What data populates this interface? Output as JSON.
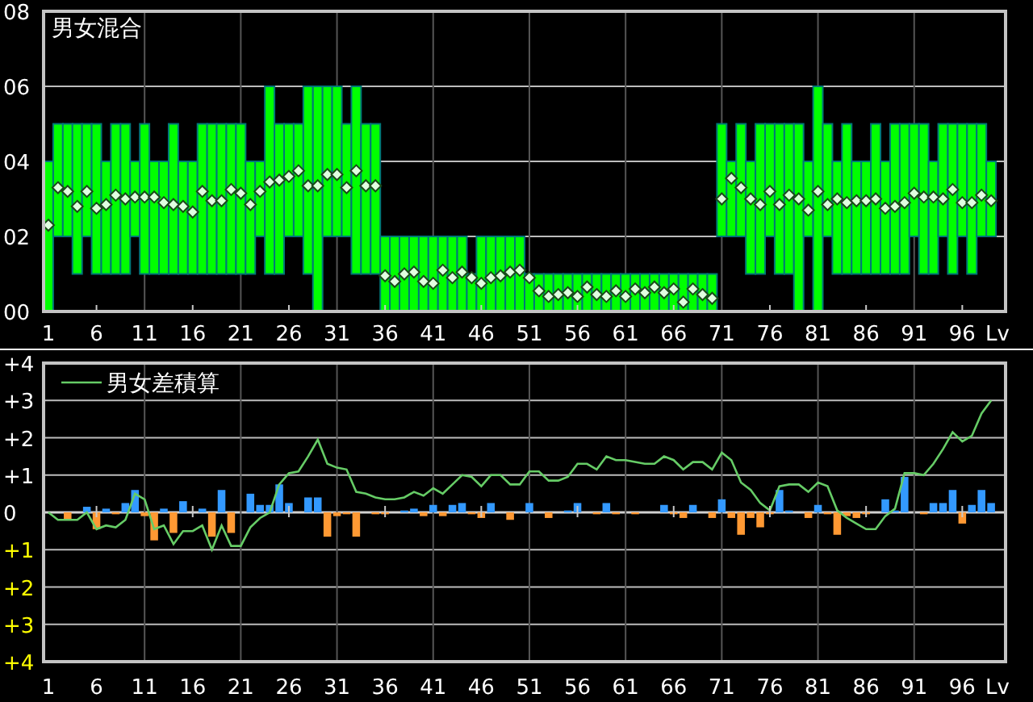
{
  "panels": [
    {
      "kind": "range",
      "chart_data": {
        "type": "bar",
        "grid": true,
        "title": "男女混合",
        "xlabel": "Lv",
        "xlim": [
          0.5,
          100.5
        ],
        "ylim": [
          0,
          8
        ],
        "yticks": [
          {
            "value": 0,
            "label": "00"
          },
          {
            "value": 2,
            "label": "02"
          },
          {
            "value": 4,
            "label": "04"
          },
          {
            "value": 6,
            "label": "06"
          },
          {
            "value": 8,
            "label": "08"
          }
        ],
        "xticks": [
          1,
          6,
          11,
          16,
          21,
          26,
          31,
          36,
          41,
          46,
          51,
          56,
          61,
          66,
          71,
          76,
          81,
          86,
          91,
          96
        ],
        "x": [
          1,
          2,
          3,
          4,
          5,
          6,
          7,
          8,
          9,
          10,
          11,
          12,
          13,
          14,
          15,
          16,
          17,
          18,
          19,
          20,
          21,
          22,
          23,
          24,
          25,
          26,
          27,
          28,
          29,
          30,
          31,
          32,
          33,
          34,
          35,
          36,
          37,
          38,
          39,
          40,
          41,
          42,
          43,
          44,
          45,
          46,
          47,
          48,
          49,
          50,
          51,
          52,
          53,
          54,
          55,
          56,
          57,
          58,
          59,
          60,
          61,
          62,
          63,
          64,
          65,
          66,
          67,
          68,
          69,
          70,
          71,
          72,
          73,
          74,
          75,
          76,
          77,
          78,
          79,
          80,
          81,
          82,
          83,
          84,
          85,
          86,
          87,
          88,
          89,
          90,
          91,
          92,
          93,
          94,
          95,
          96,
          97,
          98,
          99
        ],
        "series": [
          {
            "type": "candlestick",
            "color": "#00ff00",
            "ohlc": [
              [
                0,
                4,
                0,
                4
              ],
              [
                2,
                5,
                2,
                5
              ],
              [
                2,
                5,
                2,
                5
              ],
              [
                1,
                5,
                1,
                5
              ],
              [
                2,
                5,
                2,
                5
              ],
              [
                1,
                5,
                1,
                5
              ],
              [
                1,
                4,
                1,
                4
              ],
              [
                1,
                5,
                1,
                5
              ],
              [
                1,
                5,
                1,
                5
              ],
              [
                2,
                4,
                2,
                4
              ],
              [
                1,
                5,
                1,
                5
              ],
              [
                1,
                4,
                1,
                4
              ],
              [
                1,
                4,
                1,
                4
              ],
              [
                1,
                5,
                1,
                5
              ],
              [
                1,
                4,
                1,
                4
              ],
              [
                1,
                4,
                1,
                4
              ],
              [
                1,
                5,
                1,
                5
              ],
              [
                1,
                5,
                1,
                5
              ],
              [
                1,
                5,
                1,
                5
              ],
              [
                1,
                5,
                1,
                5
              ],
              [
                1,
                5,
                1,
                5
              ],
              [
                1,
                4,
                1,
                4
              ],
              [
                2,
                4,
                2,
                4
              ],
              [
                1,
                6,
                1,
                6
              ],
              [
                1,
                5,
                1,
                5
              ],
              [
                2,
                5,
                2,
                5
              ],
              [
                2,
                5,
                2,
                5
              ],
              [
                1,
                6,
                1,
                6
              ],
              [
                0,
                6,
                0,
                6
              ],
              [
                2,
                6,
                2,
                6
              ],
              [
                2,
                6,
                2,
                6
              ],
              [
                2,
                5,
                2,
                5
              ],
              [
                1,
                6,
                1,
                6
              ],
              [
                1,
                5,
                1,
                5
              ],
              [
                1,
                5,
                1,
                5
              ],
              [
                0,
                2,
                0,
                2
              ],
              [
                0,
                2,
                0,
                2
              ],
              [
                0,
                2,
                0,
                2
              ],
              [
                0,
                2,
                0,
                2
              ],
              [
                0,
                2,
                0,
                2
              ],
              [
                0,
                2,
                0,
                2
              ],
              [
                0,
                2,
                0,
                2
              ],
              [
                0,
                2,
                0,
                2
              ],
              [
                0,
                2,
                0,
                2
              ],
              [
                0,
                1,
                0,
                1
              ],
              [
                0,
                2,
                0,
                2
              ],
              [
                0,
                2,
                0,
                2
              ],
              [
                0,
                2,
                0,
                2
              ],
              [
                0,
                2,
                0,
                2
              ],
              [
                0,
                2,
                0,
                2
              ],
              [
                0,
                1,
                0,
                1
              ],
              [
                0,
                1,
                0,
                1
              ],
              [
                0,
                1,
                0,
                1
              ],
              [
                0,
                1,
                0,
                1
              ],
              [
                0,
                1,
                0,
                1
              ],
              [
                0,
                1,
                0,
                1
              ],
              [
                0,
                1,
                0,
                1
              ],
              [
                0,
                1,
                0,
                1
              ],
              [
                0,
                1,
                0,
                1
              ],
              [
                0,
                1,
                0,
                1
              ],
              [
                0,
                1,
                0,
                1
              ],
              [
                0,
                1,
                0,
                1
              ],
              [
                0,
                1,
                0,
                1
              ],
              [
                0,
                1,
                0,
                1
              ],
              [
                0,
                1,
                0,
                1
              ],
              [
                0,
                1,
                0,
                1
              ],
              [
                0,
                1,
                0,
                1
              ],
              [
                0,
                1,
                0,
                1
              ],
              [
                0,
                1,
                0,
                1
              ],
              [
                0,
                1,
                0,
                1
              ],
              [
                2,
                5,
                2,
                5
              ],
              [
                2,
                4,
                2,
                4
              ],
              [
                2,
                5,
                2,
                5
              ],
              [
                1,
                4,
                1,
                4
              ],
              [
                1,
                5,
                1,
                5
              ],
              [
                2,
                5,
                2,
                5
              ],
              [
                1,
                5,
                1,
                5
              ],
              [
                1,
                5,
                1,
                5
              ],
              [
                0,
                5,
                0,
                5
              ],
              [
                2,
                4,
                2,
                4
              ],
              [
                0,
                6,
                0,
                6
              ],
              [
                2,
                5,
                2,
                5
              ],
              [
                1,
                4,
                1,
                4
              ],
              [
                1,
                5,
                1,
                5
              ],
              [
                1,
                4,
                1,
                4
              ],
              [
                1,
                4,
                1,
                4
              ],
              [
                1,
                5,
                1,
                5
              ],
              [
                1,
                4,
                1,
                4
              ],
              [
                1,
                5,
                1,
                5
              ],
              [
                1,
                5,
                1,
                5
              ],
              [
                2,
                5,
                2,
                5
              ],
              [
                1,
                5,
                1,
                5
              ],
              [
                1,
                4,
                1,
                4
              ],
              [
                2,
                5,
                2,
                5
              ],
              [
                1,
                5,
                1,
                5
              ],
              [
                2,
                5,
                2,
                5
              ],
              [
                1,
                5,
                1,
                5
              ],
              [
                2,
                5,
                2,
                5
              ],
              [
                2,
                4,
                2,
                4
              ]
            ]
          },
          {
            "type": "scatter",
            "color": "#e0ffe0",
            "values": [
              2.3,
              3.3,
              3.2,
              2.8,
              3.2,
              2.75,
              2.85,
              3.1,
              3.0,
              3.05,
              3.05,
              3.05,
              2.9,
              2.85,
              2.8,
              2.65,
              3.2,
              2.95,
              2.95,
              3.25,
              3.15,
              2.85,
              3.2,
              3.45,
              3.5,
              3.6,
              3.75,
              3.35,
              3.35,
              3.65,
              3.65,
              3.3,
              3.75,
              3.35,
              3.35,
              0.95,
              0.8,
              1.0,
              1.05,
              0.8,
              0.75,
              1.1,
              0.9,
              1.05,
              0.9,
              0.75,
              0.9,
              0.95,
              1.05,
              1.1,
              0.9,
              0.55,
              0.4,
              0.45,
              0.5,
              0.4,
              0.65,
              0.45,
              0.4,
              0.55,
              0.4,
              0.6,
              0.5,
              0.65,
              0.5,
              0.6,
              0.25,
              0.6,
              0.45,
              0.35,
              3.0,
              3.55,
              3.3,
              3.0,
              2.85,
              3.2,
              2.85,
              3.1,
              3.0,
              2.7,
              3.2,
              2.85,
              3.0,
              2.9,
              2.95,
              2.95,
              3.0,
              2.75,
              2.8,
              2.9,
              3.15,
              3.05,
              3.05,
              3.0,
              3.25,
              2.9,
              2.9,
              3.1,
              2.95
            ]
          }
        ]
      }
    },
    {
      "kind": "difference",
      "chart_data": {
        "type": "bar",
        "grid": true,
        "xlabel": "Lv",
        "xlim": [
          0.5,
          100.5
        ],
        "ylim": [
          -4,
          4
        ],
        "yticks": [
          {
            "value": 4,
            "label": "+4"
          },
          {
            "value": 3,
            "label": "+3"
          },
          {
            "value": 2,
            "label": "+2"
          },
          {
            "value": 1,
            "label": "+1"
          },
          {
            "value": 0,
            "label": "0"
          },
          {
            "value": -1,
            "label": "+1"
          },
          {
            "value": -2,
            "label": "+2"
          },
          {
            "value": -3,
            "label": "+3"
          },
          {
            "value": -4,
            "label": "+4"
          }
        ],
        "xticks": [
          1,
          6,
          11,
          16,
          21,
          26,
          31,
          36,
          41,
          46,
          51,
          56,
          61,
          66,
          71,
          76,
          81,
          86,
          91,
          96
        ],
        "x": [
          1,
          2,
          3,
          4,
          5,
          6,
          7,
          8,
          9,
          10,
          11,
          12,
          13,
          14,
          15,
          16,
          17,
          18,
          19,
          20,
          21,
          22,
          23,
          24,
          25,
          26,
          27,
          28,
          29,
          30,
          31,
          32,
          33,
          34,
          35,
          36,
          37,
          38,
          39,
          40,
          41,
          42,
          43,
          44,
          45,
          46,
          47,
          48,
          49,
          50,
          51,
          52,
          53,
          54,
          55,
          56,
          57,
          58,
          59,
          60,
          61,
          62,
          63,
          64,
          65,
          66,
          67,
          68,
          69,
          70,
          71,
          72,
          73,
          74,
          75,
          76,
          77,
          78,
          79,
          80,
          81,
          82,
          83,
          84,
          85,
          86,
          87,
          88,
          89,
          90,
          91,
          92,
          93,
          94,
          95,
          96,
          97,
          98,
          99
        ],
        "series": [
          {
            "color": "#3399ff",
            "values": [
              null,
              null,
              null,
              null,
              0.15,
              null,
              0.1,
              null,
              0.25,
              0.6,
              null,
              null,
              0.1,
              null,
              0.3,
              null,
              0.1,
              null,
              0.6,
              null,
              null,
              0.5,
              0.2,
              0.2,
              0.75,
              0.25,
              null,
              0.4,
              0.4,
              null,
              null,
              null,
              null,
              null,
              null,
              null,
              null,
              0.05,
              0.1,
              null,
              0.2,
              null,
              0.2,
              0.25,
              null,
              null,
              0.25,
              null,
              null,
              null,
              0.25,
              null,
              null,
              null,
              0.05,
              0.25,
              null,
              null,
              0.25,
              null,
              null,
              null,
              null,
              null,
              0.2,
              null,
              null,
              0.2,
              null,
              null,
              0.35,
              null,
              null,
              null,
              null,
              null,
              0.6,
              0.05,
              null,
              null,
              0.2,
              null,
              null,
              null,
              null,
              null,
              null,
              0.35,
              0.05,
              0.95,
              null,
              null,
              0.25,
              0.25,
              0.6,
              null,
              0.2,
              0.6,
              0.25
            ]
          },
          {
            "color": "#ff9933",
            "values": [
              null,
              null,
              -0.2,
              null,
              null,
              -0.45,
              null,
              -0.05,
              null,
              null,
              -0.1,
              -0.75,
              null,
              -0.55,
              null,
              null,
              null,
              -0.65,
              null,
              -0.55,
              null,
              null,
              null,
              null,
              null,
              null,
              null,
              null,
              null,
              -0.65,
              -0.1,
              -0.05,
              -0.65,
              null,
              -0.05,
              -0.05,
              null,
              null,
              null,
              -0.1,
              null,
              -0.1,
              null,
              null,
              -0.05,
              -0.15,
              null,
              null,
              -0.2,
              null,
              null,
              null,
              -0.15,
              null,
              null,
              null,
              null,
              -0.05,
              null,
              -0.05,
              null,
              -0.05,
              null,
              null,
              null,
              -0.05,
              -0.15,
              null,
              null,
              -0.15,
              null,
              -0.15,
              -0.6,
              -0.15,
              -0.4,
              -0.05,
              null,
              null,
              null,
              -0.15,
              null,
              -0.05,
              -0.6,
              -0.1,
              -0.15,
              -0.05,
              null,
              null,
              null,
              null,
              null,
              -0.05,
              null,
              null,
              null,
              -0.3,
              null,
              null,
              null
            ]
          },
          {
            "type": "line",
            "name": "男女差積算",
            "color": "#66cc66",
            "values": [
              0,
              -0.2,
              -0.2,
              -0.2,
              0,
              -0.45,
              -0.35,
              -0.4,
              -0.2,
              0.5,
              0.35,
              -0.45,
              -0.35,
              -0.85,
              -0.5,
              -0.5,
              -0.35,
              -1.0,
              -0.35,
              -0.9,
              -0.9,
              -0.4,
              -0.15,
              0.0,
              0.75,
              1.05,
              1.1,
              1.5,
              1.95,
              1.3,
              1.2,
              1.15,
              0.55,
              0.5,
              0.4,
              0.35,
              0.35,
              0.4,
              0.55,
              0.45,
              0.65,
              0.5,
              0.75,
              1.0,
              0.95,
              0.7,
              1.0,
              1.0,
              0.75,
              0.75,
              1.1,
              1.1,
              0.85,
              0.85,
              0.95,
              1.3,
              1.3,
              1.15,
              1.5,
              1.4,
              1.4,
              1.35,
              1.3,
              1.3,
              1.5,
              1.4,
              1.15,
              1.35,
              1.35,
              1.15,
              1.6,
              1.4,
              0.8,
              0.6,
              0.25,
              0.05,
              0.7,
              0.75,
              0.75,
              0.55,
              0.8,
              0.7,
              0.05,
              -0.15,
              -0.3,
              -0.45,
              -0.45,
              -0.1,
              0.1,
              1.05,
              1.05,
              1.0,
              1.3,
              1.7,
              2.15,
              1.9,
              2.05,
              2.65,
              3.0
            ]
          }
        ]
      }
    }
  ]
}
